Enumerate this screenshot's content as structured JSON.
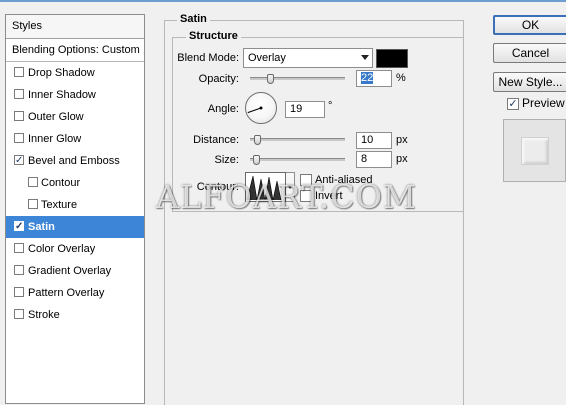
{
  "styles_panel": {
    "header": "Styles",
    "blending_options": "Blending Options: Custom",
    "items": [
      {
        "label": "Drop Shadow",
        "checked": false
      },
      {
        "label": "Inner Shadow",
        "checked": false
      },
      {
        "label": "Outer Glow",
        "checked": false
      },
      {
        "label": "Inner Glow",
        "checked": false
      },
      {
        "label": "Bevel and Emboss",
        "checked": true
      },
      {
        "label": "Contour",
        "checked": false,
        "sub": true
      },
      {
        "label": "Texture",
        "checked": false,
        "sub": true
      },
      {
        "label": "Satin",
        "checked": true,
        "selected": true
      },
      {
        "label": "Color Overlay",
        "checked": false
      },
      {
        "label": "Gradient Overlay",
        "checked": false
      },
      {
        "label": "Pattern Overlay",
        "checked": false
      },
      {
        "label": "Stroke",
        "checked": false
      }
    ]
  },
  "satin": {
    "title": "Satin",
    "structure_title": "Structure",
    "blend_mode_label": "Blend Mode:",
    "blend_mode_value": "Overlay",
    "color": "#000000",
    "opacity_label": "Opacity:",
    "opacity_value": "22",
    "opacity_unit": "%",
    "opacity_fraction": 0.22,
    "angle_label": "Angle:",
    "angle_value": "19",
    "angle_unit": "°",
    "distance_label": "Distance:",
    "distance_value": "10",
    "distance_unit": "px",
    "size_label": "Size:",
    "size_value": "8",
    "size_unit": "px",
    "contour_label": "Contour:",
    "anti_aliased_label": "Anti-aliased",
    "anti_aliased_checked": false,
    "invert_label": "Invert",
    "invert_checked": false
  },
  "buttons": {
    "ok": "OK",
    "cancel": "Cancel",
    "new_style": "New Style..."
  },
  "preview": {
    "label": "Preview",
    "checked": true
  },
  "watermark": "ALFOART.COM",
  "colors": {
    "selection": "#3d85d6",
    "default_button_border": "#3b6fb6"
  },
  "icons": {
    "check": "✓"
  }
}
